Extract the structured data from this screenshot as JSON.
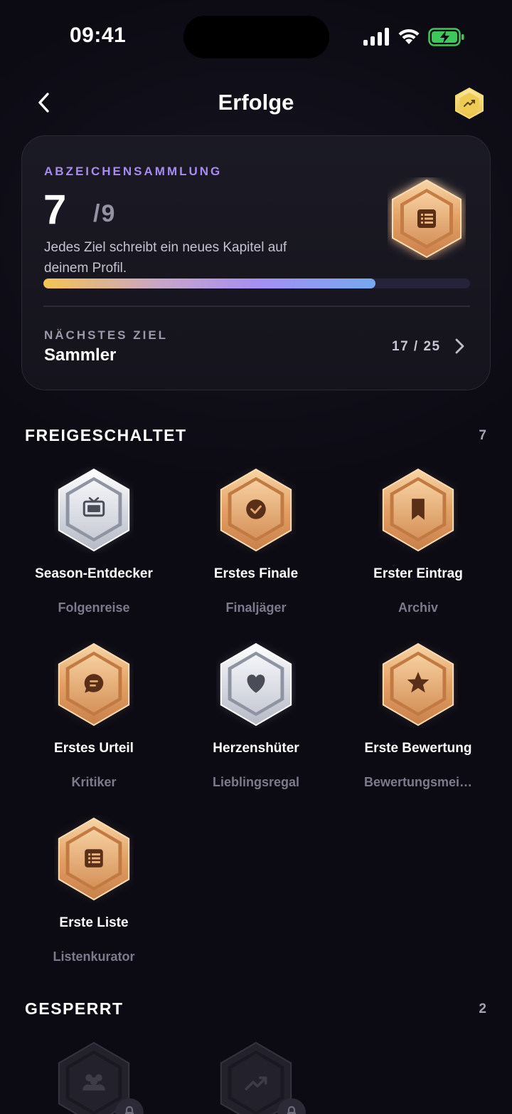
{
  "status_bar": {
    "time": "09:41"
  },
  "nav": {
    "title": "Erfolge",
    "badge_icon": "trending-up-icon"
  },
  "summary": {
    "eyebrow": "ABZEICHENSAMMLUNG",
    "count": "7",
    "total": "/9",
    "description": "Jedes Ziel schreibt ein neues Kapitel auf deinem Profil.",
    "progress_fraction": 0.778,
    "next_label": "NÄCHSTES ZIEL",
    "next_name": "Sammler",
    "next_progress": "17 / 25",
    "medal_icon": "list-icon"
  },
  "unlocked": {
    "title": "FREIGESCHALTET",
    "count": "7",
    "badges": [
      {
        "name": "Season-Entdecker",
        "subtitle": "Folgenreise",
        "tier": "silver",
        "icon": "tv-icon"
      },
      {
        "name": "Erstes Finale",
        "subtitle": "Finaljäger",
        "tier": "bronze",
        "icon": "check-circle-icon"
      },
      {
        "name": "Erster Eintrag",
        "subtitle": "Archiv",
        "tier": "bronze",
        "icon": "bookmark-icon"
      },
      {
        "name": "Erstes Urteil",
        "subtitle": "Kritiker",
        "tier": "bronze",
        "icon": "chat-icon"
      },
      {
        "name": "Herzenshüter",
        "subtitle": "Lieblingsregal",
        "tier": "silver",
        "icon": "heart-icon"
      },
      {
        "name": "Erste Bewertung",
        "subtitle": "Bewertungsmei…",
        "tier": "bronze",
        "icon": "star-icon"
      },
      {
        "name": "Erste Liste",
        "subtitle": "Listenkurator",
        "tier": "bronze",
        "icon": "list-icon"
      }
    ]
  },
  "locked": {
    "title": "GESPERRT",
    "count": "2",
    "badges": [
      {
        "icon": "users-icon"
      },
      {
        "icon": "trending-up-icon"
      }
    ]
  },
  "colors": {
    "background": "#0c0b14",
    "accent_purple": "#a98bf0",
    "bronze": "#e6a56a",
    "silver": "#d8dbe3"
  }
}
